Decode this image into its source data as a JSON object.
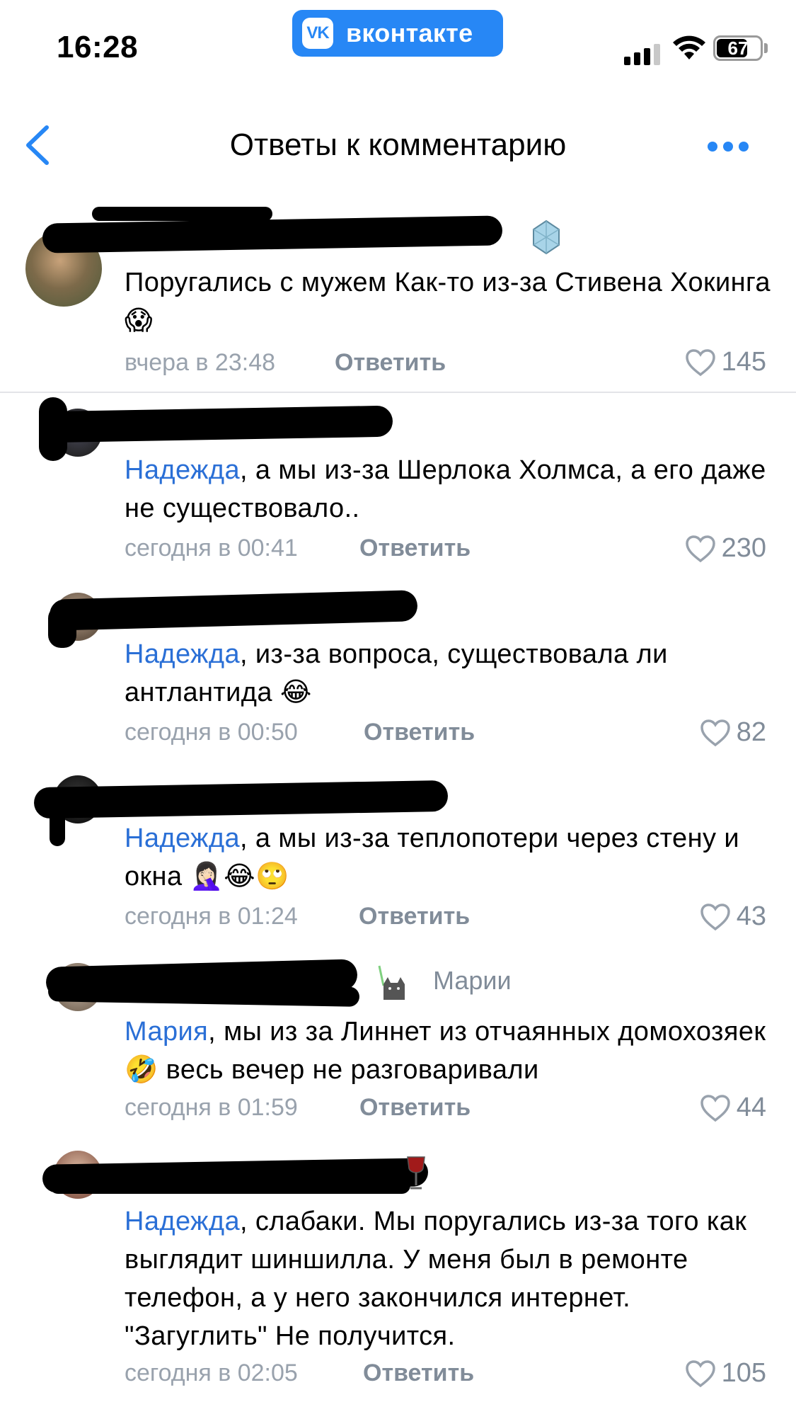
{
  "status_bar": {
    "time": "16:28",
    "app_pill": "вконтакте",
    "app_logo": "VK",
    "battery_level": "67"
  },
  "nav": {
    "title": "Ответы к комментарию"
  },
  "comments": [
    {
      "text": "Поругались с мужем Как-то из-за Стивена Хокинга 😱",
      "date": "вчера в 23:48",
      "reply_label": "Ответить",
      "likes": "145"
    },
    {
      "mention": "Надежда",
      "text": ", а мы из-за Шерлока Холмса, а его даже не существовало..",
      "date": "сегодня в 00:41",
      "reply_label": "Ответить",
      "likes": "230"
    },
    {
      "mention": "Надежда",
      "text": ", из-за вопроса, существовала ли антлантида 😂",
      "date": "сегодня в 00:50",
      "reply_label": "Ответить",
      "likes": "82"
    },
    {
      "mention": "Надежда",
      "text": ", а мы из-за теплопотери через стену и окна 🤦🏻‍♀️😂🙄",
      "date": "сегодня в 01:24",
      "reply_label": "Ответить",
      "likes": "43"
    },
    {
      "reply_to": "Марии",
      "mention": "Мария",
      "text": ", мы из за Линнет из отчаянных домохозяек🤣 весь вечер не разговаривали",
      "date": "сегодня в 01:59",
      "reply_label": "Ответить",
      "likes": "44"
    },
    {
      "mention": "Надежда",
      "text": ", слабаки. Мы поругались из-за того как выглядит шиншилла. У меня был в ремонте телефон, а у него закончился интернет. \"Загуглить\" Не получится.",
      "date": "сегодня в 02:05",
      "reply_label": "Ответить",
      "likes": "105"
    }
  ],
  "colors": {
    "accent": "#2787f5",
    "mention": "#2a6fd6",
    "secondary": "#818c99",
    "meta": "#99a2ad"
  },
  "icons": [
    "back-chevron-icon",
    "more-dots-icon",
    "heart-icon",
    "wifi-icon",
    "signal-icon",
    "battery-icon"
  ]
}
